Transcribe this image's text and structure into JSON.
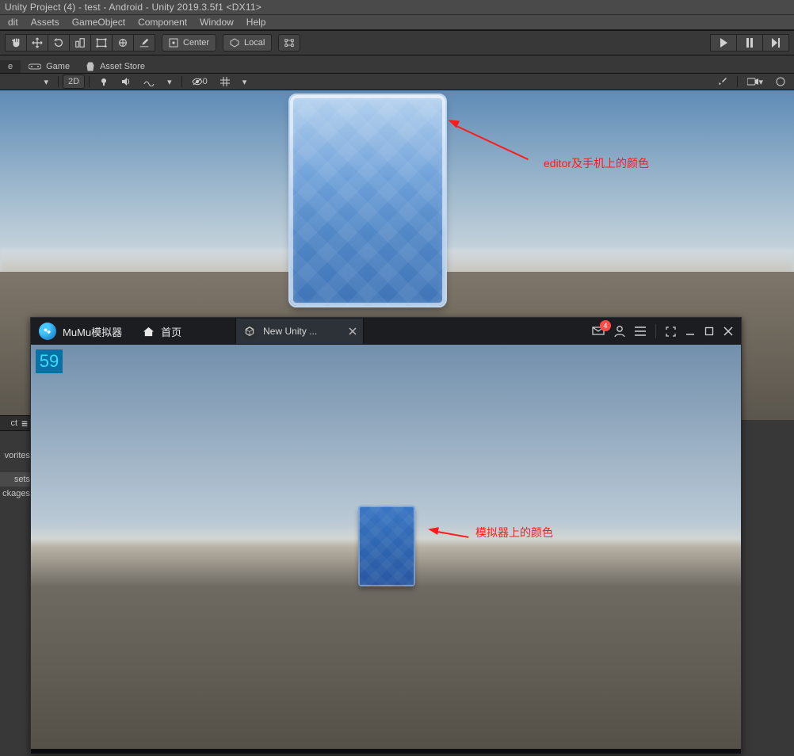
{
  "window_title": "Unity Project (4) - test - Android - Unity 2019.3.5f1 <DX11>",
  "menu": {
    "items": [
      "dit",
      "Assets",
      "GameObject",
      "Component",
      "Window",
      "Help"
    ]
  },
  "toolbarA": {
    "pivot_label": "Center",
    "handle_label": "Local"
  },
  "tabs": {
    "scene": "e",
    "game": "Game",
    "asset_store": "Asset Store"
  },
  "toolbarB": {
    "mode_2d": "2D",
    "hidden_count": "0"
  },
  "annotation_top": "editor及手机上的颜色",
  "annotation_bottom": "模拟器上的颜色",
  "project": {
    "tab_label": "ct",
    "favorites": "vorites",
    "assets": "sets",
    "packages": "ckages"
  },
  "emu": {
    "app_name": "MuMu模拟器",
    "home_label": "首页",
    "tab_title": "New Unity ...",
    "msg_badge": "4",
    "fps": "59"
  }
}
